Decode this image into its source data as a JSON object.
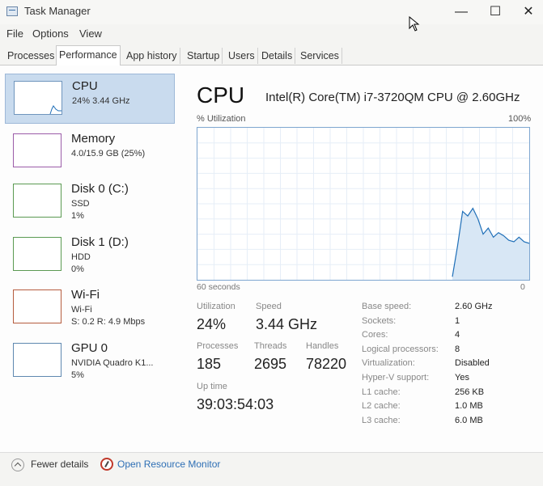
{
  "window": {
    "title": "Task Manager",
    "minimize": "—",
    "maximize": "☐",
    "close": "✕"
  },
  "menu": [
    "File",
    "Options",
    "View"
  ],
  "tabs": [
    "Processes",
    "Performance",
    "App history",
    "Startup",
    "Users",
    "Details",
    "Services"
  ],
  "active_tab": "Performance",
  "resources": [
    {
      "name": "CPU",
      "line2": "24%  3.44 GHz",
      "line3": ""
    },
    {
      "name": "Memory",
      "line2": "4.0/15.9 GB (25%)",
      "line3": ""
    },
    {
      "name": "Disk 0 (C:)",
      "line2": "SSD",
      "line3": "1%"
    },
    {
      "name": "Disk 1 (D:)",
      "line2": "HDD",
      "line3": "0%"
    },
    {
      "name": "Wi-Fi",
      "line2": "Wi-Fi",
      "line3": "S: 0.2  R: 4.9 Mbps"
    },
    {
      "name": "GPU 0",
      "line2": "NVIDIA Quadro K1...",
      "line3": "5%"
    }
  ],
  "cpu": {
    "title": "CPU",
    "model": "Intel(R) Core(TM) i7-3720QM CPU @ 2.60GHz",
    "graph_label": "% Utilization",
    "graph_max": "100%",
    "graph_span": "60 seconds",
    "graph_min": "0",
    "utilization_series": [
      0,
      0,
      0,
      0,
      0,
      0,
      0,
      0,
      0,
      0,
      0,
      0,
      0,
      0,
      0,
      0,
      0,
      0,
      0,
      0,
      0,
      0,
      0,
      0,
      0,
      0,
      0,
      0,
      0,
      0,
      0,
      0,
      0,
      0,
      0,
      0,
      0,
      0,
      0,
      0,
      0,
      0,
      0,
      0,
      0,
      0,
      0,
      0,
      0,
      0,
      0,
      0,
      0,
      0,
      0,
      0,
      0,
      0,
      0,
      0,
      0,
      0,
      0,
      0,
      0,
      0,
      0,
      0,
      0,
      0,
      0,
      0,
      0,
      0,
      0,
      0,
      0,
      0,
      0,
      0,
      0,
      0,
      0,
      0,
      0,
      0,
      0,
      0,
      0,
      0,
      0,
      0,
      0,
      0,
      0,
      0,
      0,
      0,
      0,
      0,
      0,
      0,
      0,
      0,
      0,
      0,
      0,
      0,
      0,
      0,
      0,
      0,
      0,
      0,
      0,
      0,
      0,
      0,
      0,
      0,
      0,
      0,
      0,
      0,
      0,
      0,
      0,
      0,
      0,
      0,
      0,
      0,
      0,
      0,
      0,
      0,
      0,
      0,
      0,
      0,
      0,
      0,
      0,
      0,
      0,
      0,
      0,
      0,
      0,
      0,
      0,
      0,
      0,
      0,
      0,
      0,
      0,
      0,
      0,
      0,
      0,
      0,
      0,
      0,
      0,
      0,
      0,
      0,
      0,
      0,
      0,
      0,
      0,
      0,
      0,
      0,
      0,
      0,
      0,
      0,
      0,
      0,
      0,
      0,
      0,
      0,
      0,
      0,
      0,
      0,
      0,
      0,
      0,
      0,
      0,
      0,
      0,
      0,
      0,
      0
    ],
    "recent_utilization": [
      2,
      22,
      45,
      42,
      47,
      40,
      30,
      34,
      28,
      31,
      29,
      26,
      25,
      28,
      25,
      24
    ],
    "stats": {
      "utilization_label": "Utilization",
      "utilization": "24%",
      "speed_label": "Speed",
      "speed": "3.44 GHz",
      "processes_label": "Processes",
      "processes": "185",
      "threads_label": "Threads",
      "threads": "2695",
      "handles_label": "Handles",
      "handles": "78220",
      "uptime_label": "Up time",
      "uptime": "39:03:54:03"
    },
    "specs": [
      {
        "label": "Base speed:",
        "value": "2.60 GHz"
      },
      {
        "label": "Sockets:",
        "value": "1"
      },
      {
        "label": "Cores:",
        "value": "4"
      },
      {
        "label": "Logical processors:",
        "value": "8"
      },
      {
        "label": "Virtualization:",
        "value": "Disabled"
      },
      {
        "label": "Hyper-V support:",
        "value": "Yes"
      },
      {
        "label": "L1 cache:",
        "value": "256 KB"
      },
      {
        "label": "L2 cache:",
        "value": "1.0 MB"
      },
      {
        "label": "L3 cache:",
        "value": "6.0 MB"
      }
    ]
  },
  "footer": {
    "fewer_details": "Fewer details",
    "open_monitor": "Open Resource Monitor"
  },
  "colors": {
    "cpu_line": "#1f6fb8",
    "cpu_fill": "#d8e7f5",
    "grid": "#e6eef7",
    "selected": "#c9dbee"
  }
}
